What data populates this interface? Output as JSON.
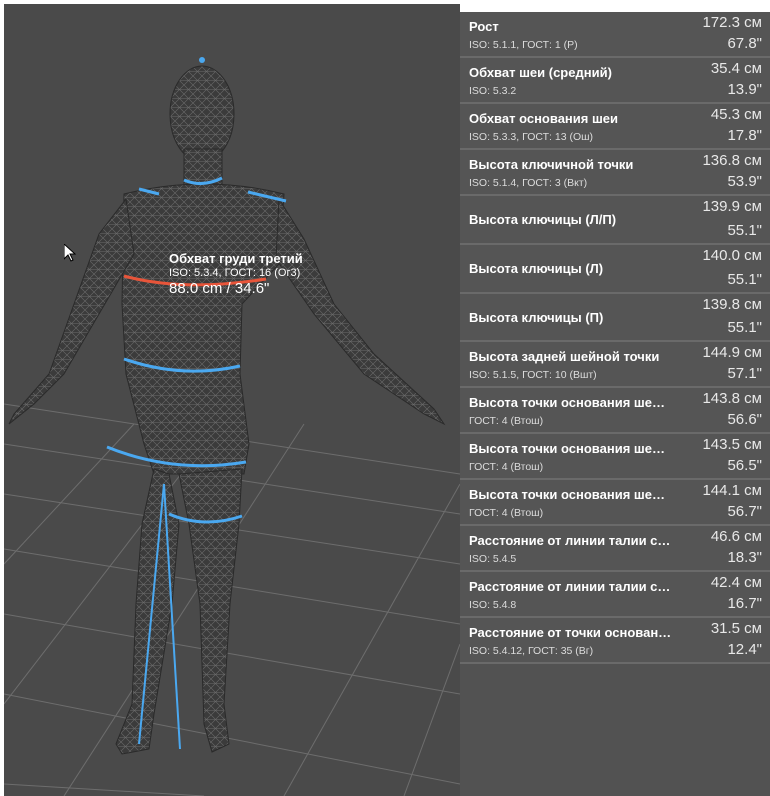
{
  "annotation": {
    "title": "Обхват груди третий",
    "subtitle": "ISO: 5.3.4, ГОСТ: 16 (Ог3)",
    "value": "88.0 cm / 34.6\""
  },
  "measurements": [
    {
      "name": "Рост",
      "sub": "ISO: 5.1.1, ГОСТ: 1 (Р)",
      "cm": "172.3 см",
      "inch": "67.8\""
    },
    {
      "name": "Обхват шеи (средний)",
      "sub": "ISO: 5.3.2",
      "cm": "35.4 см",
      "inch": "13.9\""
    },
    {
      "name": "Обхват основания шеи",
      "sub": "ISO: 5.3.3, ГОСТ: 13 (Ош)",
      "cm": "45.3 см",
      "inch": "17.8\""
    },
    {
      "name": "Высота ключичной точки",
      "sub": "ISO: 5.1.4, ГОСТ: 3 (Вкт)",
      "cm": "136.8 см",
      "inch": "53.9\""
    },
    {
      "name": "Высота ключицы (Л/П)",
      "sub": "",
      "cm": "139.9 см",
      "inch": "55.1\""
    },
    {
      "name": "Высота ключицы (Л)",
      "sub": "",
      "cm": "140.0 см",
      "inch": "55.1\""
    },
    {
      "name": "Высота ключицы (П)",
      "sub": "",
      "cm": "139.8 см",
      "inch": "55.1\""
    },
    {
      "name": "Высота задней шейной точки",
      "sub": "ISO: 5.1.5, ГОСТ: 10 (Вшт)",
      "cm": "144.9 см",
      "inch": "57.1\""
    },
    {
      "name": "Высота точки основания ше…",
      "sub": "ГОСТ: 4 (Втош)",
      "cm": "143.8 см",
      "inch": "56.6\""
    },
    {
      "name": "Высота точки основания ше…",
      "sub": "ГОСТ: 4 (Втош)",
      "cm": "143.5 см",
      "inch": "56.5\""
    },
    {
      "name": "Высота точки основания ше…",
      "sub": "ГОСТ: 4 (Втош)",
      "cm": "144.1 см",
      "inch": "56.7\""
    },
    {
      "name": "Расстояние от линии талии с…",
      "sub": "ISO: 5.4.5",
      "cm": "46.6 см",
      "inch": "18.3\""
    },
    {
      "name": "Расстояние от линии талии с…",
      "sub": "ISO: 5.4.8",
      "cm": "42.4 см",
      "inch": "16.7\""
    },
    {
      "name": "Расстояние от точки основан…",
      "sub": "ISO: 5.4.12, ГОСТ: 35 (Вг)",
      "cm": "31.5 см",
      "inch": "12.4\""
    }
  ],
  "colors": {
    "background": "#4a4a4a",
    "body_mesh": "#3a3a3a",
    "measure_line": "#4aa8f0",
    "active_line": "#e8553a",
    "panel_row": "#555555"
  },
  "icons": {
    "cursor": "mouse-pointer-icon"
  }
}
